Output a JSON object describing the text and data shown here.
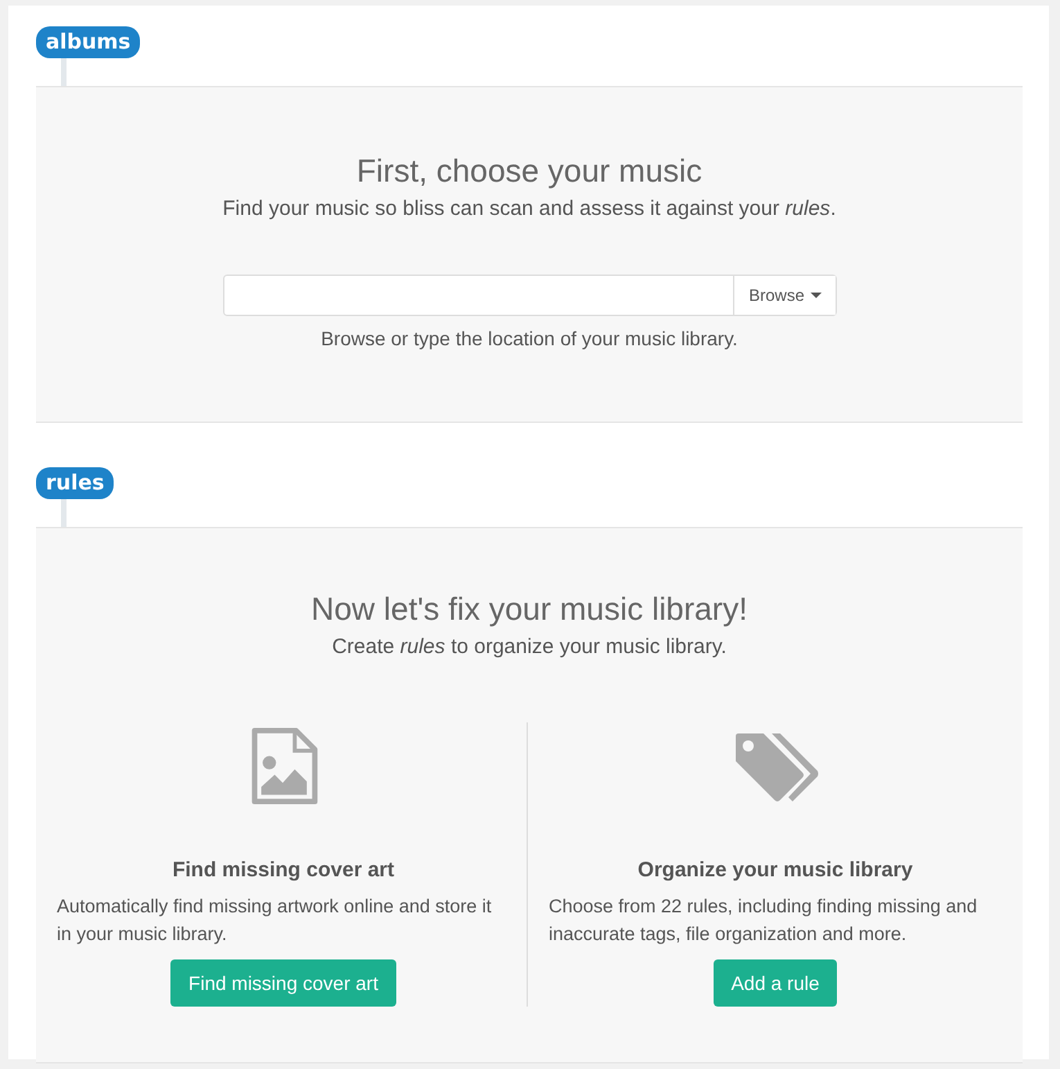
{
  "sections": [
    {
      "badge": "albums",
      "kind": "browse",
      "title": "First, choose your music",
      "subtitle": "Find your music so bliss can scan and assess it against your *rules*.",
      "browse": {
        "button": "Browse",
        "help": "Browse or type the location of your music library."
      }
    },
    {
      "badge": "rules",
      "kind": "features",
      "title": "Now let's fix your music library!",
      "subtitle": "Create *rules* to organize your music library.",
      "features": [
        {
          "kind": "image-file",
          "heading": "Find missing cover art",
          "description": "Automatically find missing artwork online and store it in your music library.",
          "button": "Find missing cover art"
        },
        {
          "kind": "tags",
          "heading": "Organize your music library",
          "description": "Choose from 22 rules, including finding missing and inaccurate tags, file organization and more.",
          "button": "Add a rule"
        }
      ]
    }
  ]
}
